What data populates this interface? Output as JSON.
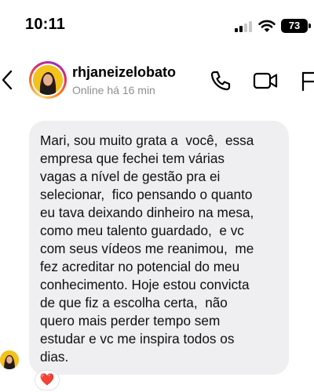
{
  "status_bar": {
    "time": "10:11",
    "battery_level": "73"
  },
  "header": {
    "username": "rhjaneizelobato",
    "presence": "Online há 16 min",
    "icons": [
      "back-chevron-icon",
      "phone-icon",
      "video-camera-icon",
      "flag-icon"
    ]
  },
  "message": {
    "text": "Mari, sou muito grata a  você,  essa\nempresa que fechei tem várias\nvagas a nível de gestão pra ei\nselecionar,  fico pensando o quanto\neu tava deixando dinheiro na mesa,\ncomo meu talento guardado,  e vc\ncom seus vídeos me reanimou,  me\nfez acreditar no potencial do meu\nconhecimento. Hoje estou convicta\nde que fiz a escolha certa,  não\nquero mais perder tempo sem\nestudar e vc me inspira todos os\ndias.",
    "reaction": "❤️"
  },
  "colors": {
    "bubble": "#efeff2",
    "secondary_text": "#8e8e8e",
    "reaction_heart": "#ed1c24"
  }
}
